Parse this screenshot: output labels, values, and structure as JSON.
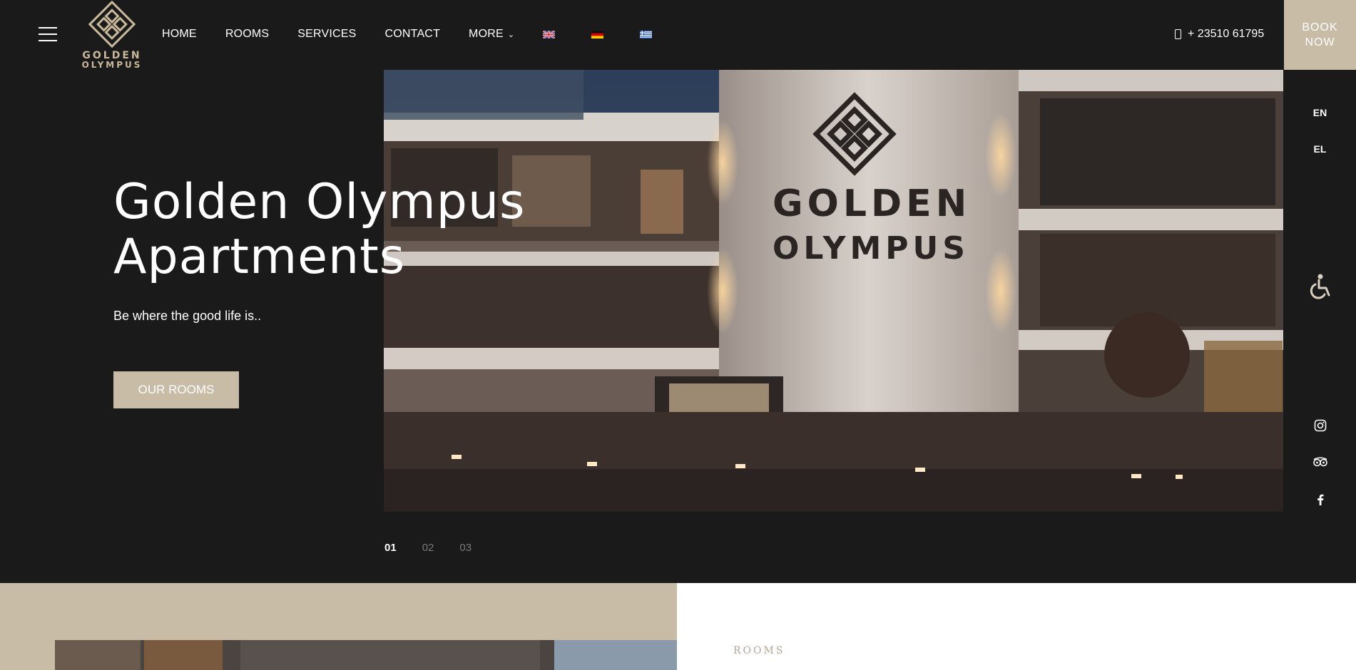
{
  "header": {
    "brand_line1": "GOLDEN",
    "brand_line2": "OLYMPUS",
    "nav": [
      {
        "label": "HOME"
      },
      {
        "label": "ROOMS"
      },
      {
        "label": "SERVICES"
      },
      {
        "label": "CONTACT"
      },
      {
        "label": "MORE"
      }
    ],
    "flags": [
      "uk-flag",
      "germany-flag",
      "greece-flag"
    ],
    "phone": "+ 23510 61795",
    "book_line1": "BOOK",
    "book_line2": "NOW"
  },
  "sidebar": {
    "languages": [
      "EN",
      "EL"
    ],
    "icons": [
      "accessibility-icon",
      "instagram-icon",
      "tripadvisor-icon",
      "facebook-icon"
    ]
  },
  "hero": {
    "title_line1": "Golden Olympus",
    "title_line2": "Apartments",
    "subtitle": "Be where the good life is..",
    "button": "OUR ROOMS",
    "building_line1": "GOLDEN",
    "building_line2": "OLYMPUS",
    "slides": [
      "01",
      "02",
      "03"
    ],
    "active_slide": "01"
  },
  "rooms_section": {
    "label": "ROOMS"
  },
  "colors": {
    "background": "#1a1a1b",
    "accent": "#c9bca6",
    "gold": "#c9b99a"
  }
}
